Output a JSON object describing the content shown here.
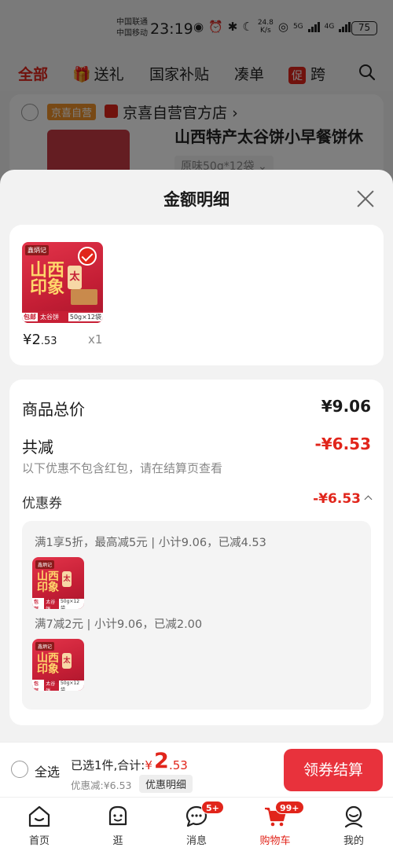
{
  "status_bar": {
    "carrier_1": "中国联通",
    "carrier_2": "中国移动",
    "time": "23:19",
    "net_speed_value": "24.8",
    "net_speed_unit": "K/s",
    "net_type_1": "5G",
    "net_type_2": "4G",
    "battery": "75"
  },
  "top_tabs": {
    "all": "全部",
    "gift": "送礼",
    "gov_subsidy": "国家补贴",
    "cou_dan": "凑单",
    "promo_badge": "促",
    "promo_label": "跨"
  },
  "shop": {
    "tag": "京喜自营",
    "name": "京喜自营官方店",
    "arrow": "›",
    "product_title": "山西特产太谷饼小早餐饼休",
    "product_spec": "原味50g*12袋"
  },
  "sheet": {
    "title": "金额明细"
  },
  "item": {
    "brand": "鑫炳记",
    "big_text_1": "山西",
    "big_text_2": "印象",
    "tai_char": "太",
    "strip_post": "包邮",
    "strip_name": "太谷饼",
    "strip_spec": "50g×12袋",
    "price_symbol_int": "¥2",
    "price_cents": ".53",
    "quantity": "x1"
  },
  "detail": {
    "total_label": "商品总价",
    "total_value": "¥9.06",
    "reduce_label": "共减",
    "reduce_value": "-¥6.53",
    "note": "以下优惠不包含红包，请在结算页查看",
    "coupon_label": "优惠券",
    "coupon_value": "-¥6.53",
    "rules": [
      {
        "text": "满1享5折，最高减5元 | 小计9.06，已减4.53"
      },
      {
        "text": "满7减2元 | 小计9.06，已减2.00"
      }
    ]
  },
  "checkout": {
    "select_all": "全选",
    "summary": "已选1件,合计:",
    "total_yen": "¥",
    "total_int": "2",
    "total_dec": ".53",
    "discount": "优惠减:¥6.53",
    "detail_button": "优惠明细",
    "checkout_button": "领券结算"
  },
  "nav": {
    "home": "首页",
    "browse": "逛",
    "messages": "消息",
    "messages_badge": "5+",
    "cart": "购物车",
    "cart_badge": "99+",
    "mine": "我的"
  },
  "colors": {
    "accent": "#e1251b",
    "checkout_button": "#e8323c"
  }
}
